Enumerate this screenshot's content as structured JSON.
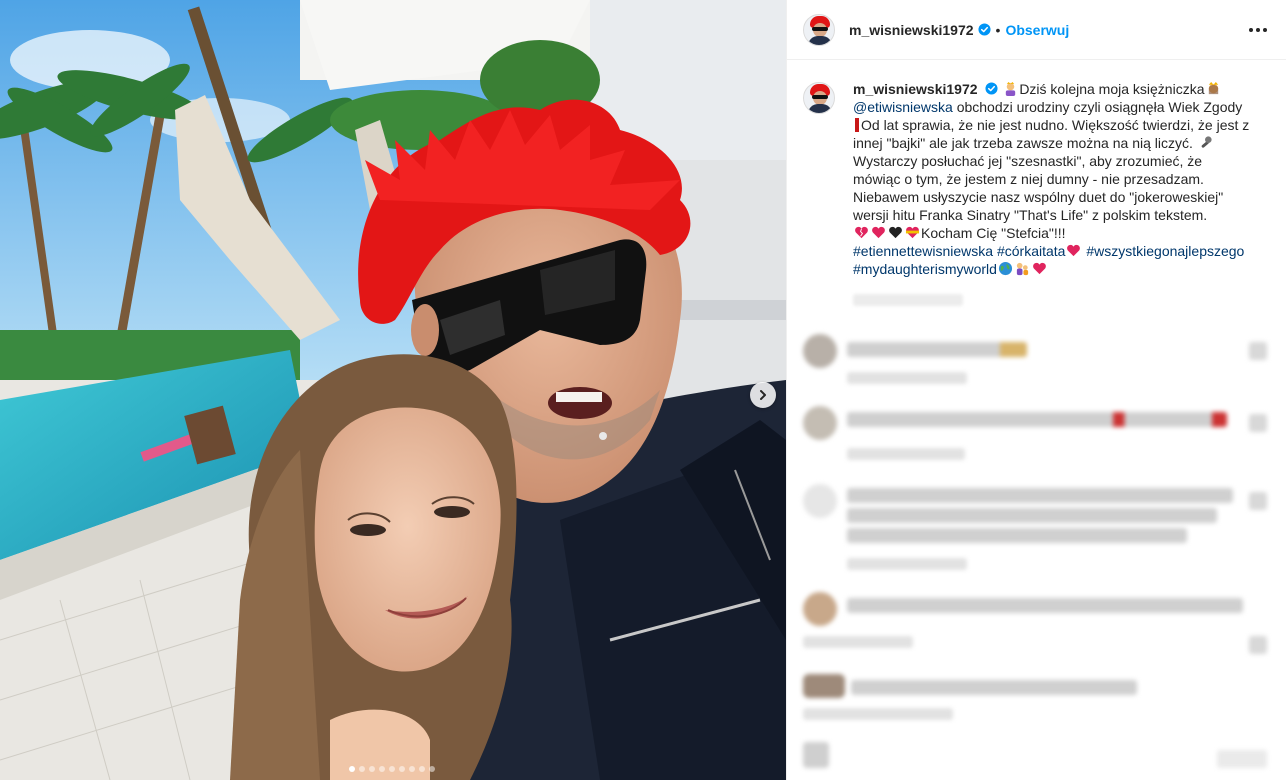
{
  "post": {
    "username": "m_wisniewski1972",
    "separator": "•",
    "follow_label": "Obserwuj",
    "verified_icon": "verified-badge-icon",
    "more_icon": "more-options-icon"
  },
  "carousel": {
    "slide_count": 9,
    "active_slide": 1,
    "next_icon": "chevron-right-icon"
  },
  "caption": {
    "username": "m_wisniewski1972",
    "line_intro": "Dziś kolejna moja księżniczka",
    "mention": "@etiwisniewska",
    "body_1": " obchodzi urodziny czyli osiągnęła Wiek Zgody ",
    "body_2": "Od lat sprawia, że nie jest nudno. Większość twierdzi, że jest z innej \"bajki\" ale jak trzeba zawsze można na nią liczyć. ",
    "body_3": "Wystarczy posłuchać jej \"szesnastki\", aby zrozumieć, że mówiąc o tym, że jestem z niej dumny - nie przesadzam. Niebawem usłyszycie nasz wspólny duet do \"jokeroweskiej\" wersji hitu Franka Sinatry \"That's Life\" z polskim tekstem.",
    "love_line": "Kocham Cię \"Stefcia\"!!!",
    "hashtag_1": "#etiennettewisniewska",
    "hashtag_2": "#córkaitata",
    "hashtag_3": "#wszystkiegonajlepszego",
    "hashtag_4": "#mydaughterismyworld",
    "emojis": [
      "princess-emoji",
      "red-mark-emoji",
      "microphone-emoji",
      "heart-emojis",
      "globe-emoji",
      "family-emoji"
    ]
  },
  "colors": {
    "accent": "#0095f6",
    "link": "#00376b",
    "verified": "#0095f6",
    "hair": "#e01616"
  }
}
